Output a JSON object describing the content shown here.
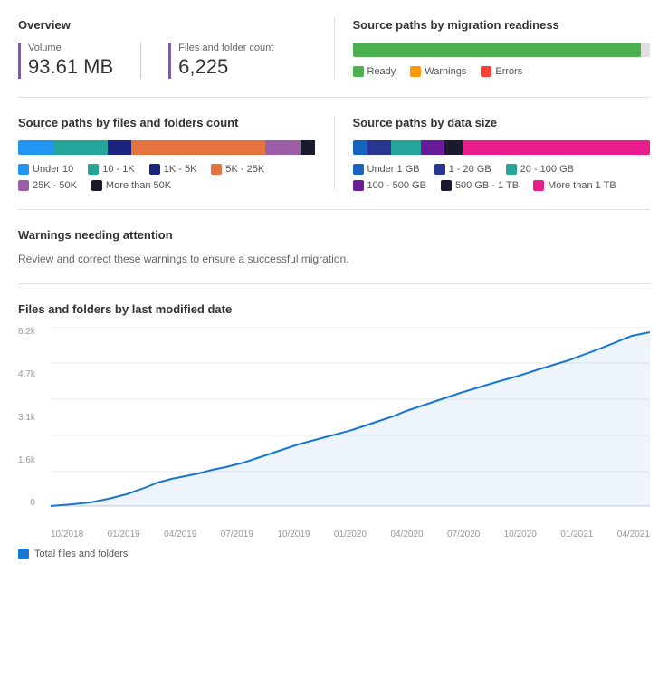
{
  "overview": {
    "title": "Overview",
    "volume_label": "Volume",
    "volume_value": "93.61 MB",
    "files_label": "Files and folder count",
    "files_value": "6,225"
  },
  "readiness": {
    "title": "Source paths by migration readiness",
    "bar_percent": 97,
    "legend": [
      {
        "label": "Ready",
        "color": "#4caf50"
      },
      {
        "label": "Warnings",
        "color": "#ff9800"
      },
      {
        "label": "Errors",
        "color": "#f44336"
      }
    ]
  },
  "files_folders_chart": {
    "title": "Source paths by files and folders count",
    "segments": [
      {
        "label": "Under 10",
        "color": "#2196f3",
        "percent": 12
      },
      {
        "label": "10 - 1K",
        "color": "#26a69a",
        "percent": 18
      },
      {
        "label": "1K - 5K",
        "color": "#1a237e",
        "percent": 8
      },
      {
        "label": "5K - 25K",
        "color": "#e57340",
        "percent": 45
      },
      {
        "label": "25K - 50K",
        "color": "#9c5fa7",
        "percent": 12
      },
      {
        "label": "More than 50K",
        "color": "#1a1a2e",
        "percent": 5
      }
    ]
  },
  "datasize_chart": {
    "title": "Source paths by data size",
    "segments": [
      {
        "label": "Under 1 GB",
        "color": "#1565c0",
        "percent": 5
      },
      {
        "label": "1 - 20 GB",
        "color": "#283593",
        "percent": 8
      },
      {
        "label": "20 - 100 GB",
        "color": "#26a69a",
        "percent": 10
      },
      {
        "label": "100 - 500 GB",
        "color": "#6a1b9a",
        "percent": 8
      },
      {
        "label": "500 GB - 1 TB",
        "color": "#1a1a2e",
        "percent": 6
      },
      {
        "label": "More than 1 TB",
        "color": "#e91e8c",
        "percent": 63
      }
    ]
  },
  "warnings": {
    "title": "Warnings needing attention",
    "description": "Review and correct these warnings to ensure a successful migration."
  },
  "timeline_chart": {
    "title": "Files and folders by last modified date",
    "y_labels": [
      "6.2k",
      "4.7k",
      "3.1k",
      "1.6k",
      "0"
    ],
    "x_labels": [
      "10/2018",
      "01/2019",
      "04/2019",
      "07/2019",
      "10/2019",
      "01/2020",
      "04/2020",
      "07/2020",
      "10/2020",
      "01/2021",
      "04/2021"
    ],
    "legend_label": "Total files and folders",
    "line_color": "#1976d2"
  }
}
